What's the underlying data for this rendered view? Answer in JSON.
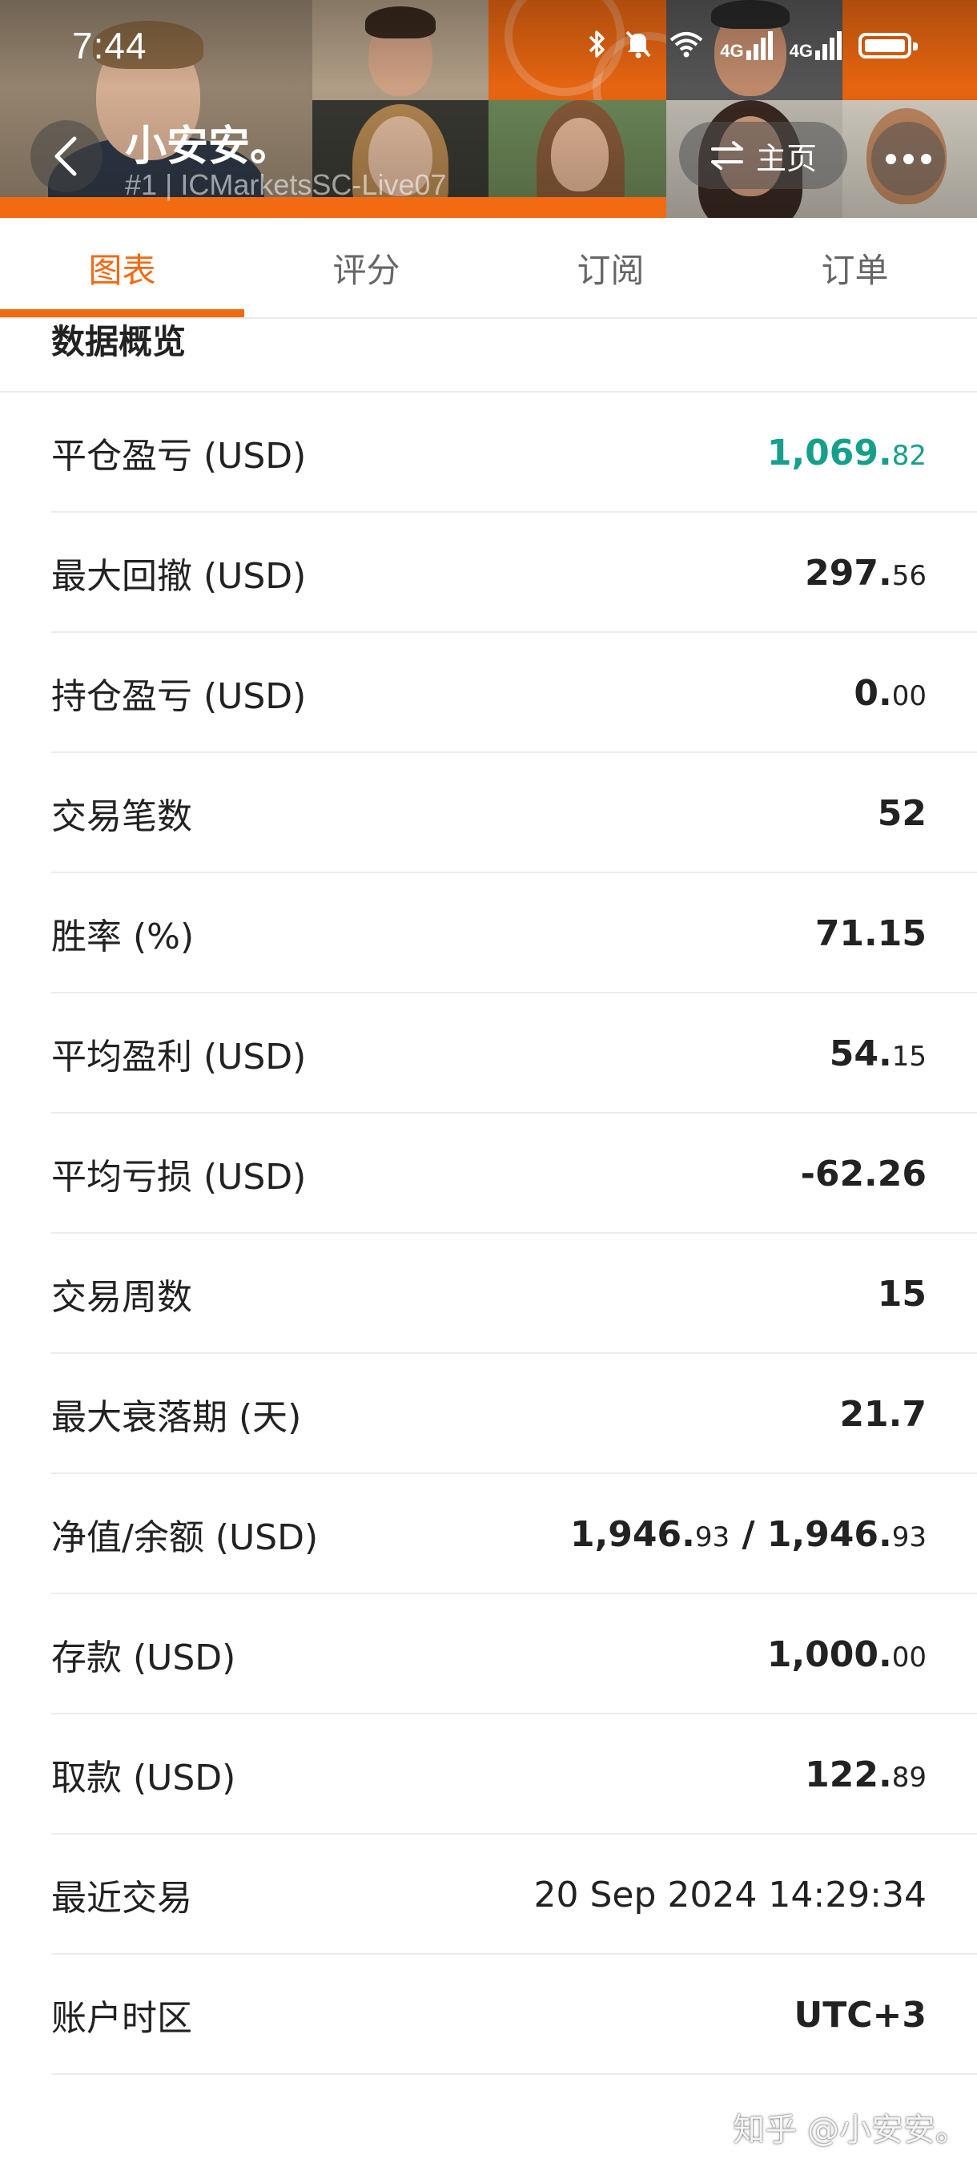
{
  "status_bar": {
    "time": "7:44",
    "net1": "4G",
    "net2": "4G"
  },
  "header": {
    "title": "小安安。",
    "subtitle": "#1 | ICMarketsSC-Live07",
    "home_label": "主页",
    "accent_color": "#f26a12"
  },
  "tabs": [
    {
      "label": "图表",
      "active": true
    },
    {
      "label": "评分",
      "active": false
    },
    {
      "label": "订阅",
      "active": false
    },
    {
      "label": "订单",
      "active": false
    }
  ],
  "overview": {
    "title": "数据概览",
    "rows": [
      {
        "label": "平仓盈亏 (USD)",
        "int": "1,069.",
        "dec": "82",
        "color": "#16a08b"
      },
      {
        "label": "最大回撤 (USD)",
        "int": "297.",
        "dec": "56"
      },
      {
        "label": "持仓盈亏 (USD)",
        "int": "0.",
        "dec": "00"
      },
      {
        "label": "交易笔数",
        "int": "52",
        "dec": ""
      },
      {
        "label": "胜率 (%)",
        "int": "71.15",
        "dec": ""
      },
      {
        "label": "平均盈利 (USD)",
        "int": "54.",
        "dec": "15"
      },
      {
        "label": "平均亏损 (USD)",
        "int": "-62.26",
        "dec": ""
      },
      {
        "label": "交易周数",
        "int": "15",
        "dec": ""
      },
      {
        "label": "最大衰落期 (天)",
        "int": "21.7",
        "dec": ""
      },
      {
        "label": "净值/余额 (USD)",
        "int": "1,946.",
        "dec": "93",
        "int2": " / 1,946.",
        "dec2": "93"
      },
      {
        "label": "存款 (USD)",
        "int": "1,000.",
        "dec": "00"
      },
      {
        "label": "取款 (USD)",
        "int": "122.",
        "dec": "89"
      },
      {
        "label": "最近交易",
        "int": "20 Sep 2024 14:29:34",
        "dec": ""
      },
      {
        "label": "账户时区",
        "int": "UTC+3",
        "dec": ""
      }
    ]
  },
  "watermark": "知乎 @小安安。"
}
